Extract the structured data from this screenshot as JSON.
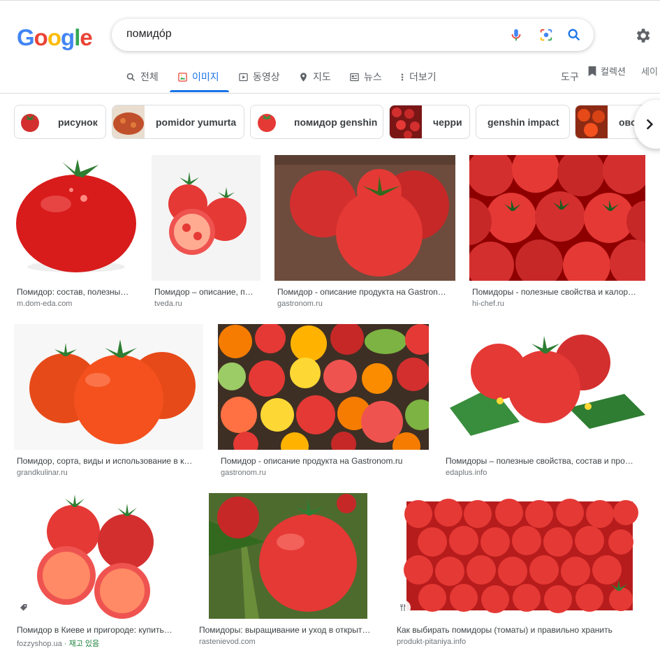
{
  "header": {
    "logo_letters": [
      {
        "ch": "G",
        "color": "#4285f4"
      },
      {
        "ch": "o",
        "color": "#ea4335"
      },
      {
        "ch": "o",
        "color": "#fbbc05"
      },
      {
        "ch": "g",
        "color": "#4285f4"
      },
      {
        "ch": "l",
        "color": "#34a853"
      },
      {
        "ch": "e",
        "color": "#ea4335"
      }
    ],
    "search_query": "помидóр",
    "icons": [
      "mic-icon",
      "camera-lens-icon",
      "search-icon",
      "gear-icon"
    ]
  },
  "tabs": [
    {
      "label": "전체",
      "icon": "search-icon"
    },
    {
      "label": "이미지",
      "icon": "image-icon"
    },
    {
      "label": "동영상",
      "icon": "video-icon"
    },
    {
      "label": "지도",
      "icon": "map-pin-icon"
    },
    {
      "label": "뉴스",
      "icon": "news-icon"
    },
    {
      "label": "더보기",
      "icon": "more-vert-icon"
    }
  ],
  "toolbar": {
    "tools_label": "도구",
    "collections_label": "컬렉션",
    "safesearch_label": "세이"
  },
  "chips": [
    {
      "label": "рисунок",
      "thumb": "#d32f2f"
    },
    {
      "label": "pomidor yumurta",
      "thumb": "#c0502b"
    },
    {
      "label": "помидор genshin",
      "thumb": "#e53935"
    },
    {
      "label": "черри",
      "thumb": "#c62828"
    },
    {
      "label": "genshin impact",
      "thumb": ""
    },
    {
      "label": "овощ",
      "thumb": "#d84315"
    }
  ],
  "results": [
    {
      "title": "Помидор: состав, полезны…",
      "source": "m.dom-eda.com",
      "bg": "#ffffff"
    },
    {
      "title": "Помидор – описание, п…",
      "source": "tveda.ru",
      "bg": "#f4f4f4"
    },
    {
      "title": "Помидор - описание продукта на Gastron…",
      "source": "gastronom.ru",
      "bg": "#6d4c3d"
    },
    {
      "title": "Помидоры - полезные свойства и калор…",
      "source": "hi-chef.ru",
      "bg": "#b71c1c"
    },
    {
      "title": "Помидор, сорта, виды и использование в к…",
      "source": "grandkulinar.ru",
      "bg": "#f7f7f7"
    },
    {
      "title": "Помидор - описание продукта на Gastronom.ru",
      "source": "gastronom.ru",
      "bg": "#3e2f24"
    },
    {
      "title": "Помидоры – полезные свойства, состав и про…",
      "source": "edaplus.info",
      "bg": "#ffffff"
    },
    {
      "title": "Помидор в Киеве и пригороде: купить…",
      "source": "fozzyshop.ua",
      "stock": " · 재고 있음",
      "bg": "#ffffff"
    },
    {
      "title": "Помидоры: выращивание и уход в открыт…",
      "source": "rastenievod.com",
      "bg": "#4e6b2e"
    },
    {
      "title": "Как выбирать помидоры (томаты) и правильно хранить",
      "source": "produkt-pitaniya.info",
      "bg": "#ffffff"
    }
  ],
  "colors": {
    "accent": "#1a73e8",
    "tomato": "#e53935",
    "leaf": "#2e7d32"
  }
}
